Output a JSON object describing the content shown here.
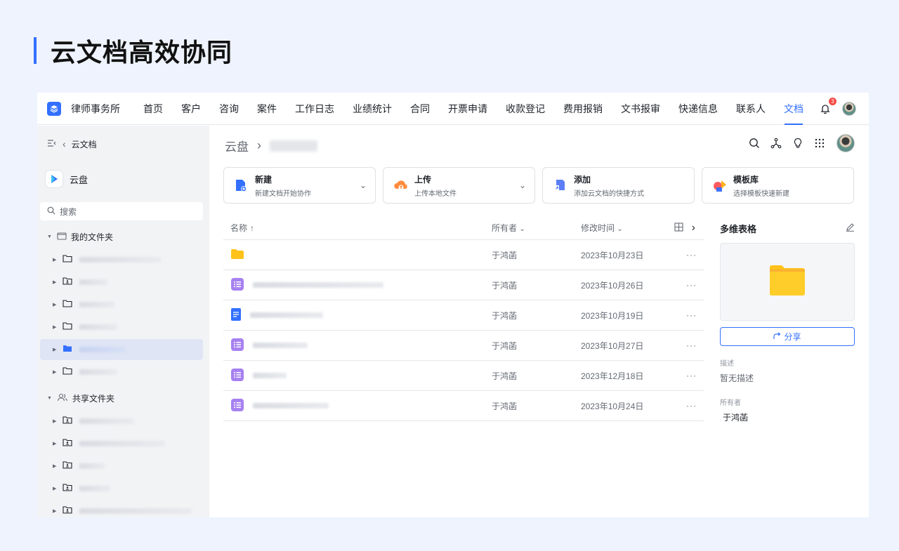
{
  "hero": {
    "title": "云文档高效协同"
  },
  "topnav": {
    "brand": "律师事务所",
    "items": [
      "首页",
      "客户",
      "咨询",
      "案件",
      "工作日志",
      "业绩统计",
      "合同",
      "开票申请",
      "收款登记",
      "费用报销",
      "文书报审",
      "快递信息",
      "联系人",
      "文档"
    ],
    "active": "文档",
    "notification_count": "3"
  },
  "sidebar": {
    "back_label": "云文档",
    "drive_label": "云盘",
    "search_placeholder": "搜索",
    "my_folder": "我的文件夹",
    "shared_folder": "共享文件夹"
  },
  "main": {
    "breadcrumb_root": "云盘",
    "cards": [
      {
        "title": "新建",
        "sub": "新建文档开始协作",
        "has_menu": true
      },
      {
        "title": "上传",
        "sub": "上传本地文件",
        "has_menu": true
      },
      {
        "title": "添加",
        "sub": "添加云文档的快捷方式",
        "has_menu": false
      },
      {
        "title": "模板库",
        "sub": "选择模板快速新建",
        "has_menu": false
      }
    ],
    "table": {
      "col_name": "名称",
      "col_owner": "所有者",
      "col_time": "修改时间",
      "rows": [
        {
          "type": "folder",
          "owner": "于鸿菡",
          "time": "2023年10月23日"
        },
        {
          "type": "sheet",
          "owner": "于鸿菡",
          "time": "2023年10月26日"
        },
        {
          "type": "doc",
          "owner": "于鸿菡",
          "time": "2023年10月19日"
        },
        {
          "type": "sheet",
          "owner": "于鸿菡",
          "time": "2023年10月27日"
        },
        {
          "type": "sheet",
          "owner": "于鸿菡",
          "time": "2023年12月18日"
        },
        {
          "type": "sheet",
          "owner": "于鸿菡",
          "time": "2023年10月24日"
        }
      ],
      "more": "···"
    }
  },
  "panel": {
    "title": "多维表格",
    "share_label": "分享",
    "desc_label": "描述",
    "desc_value": "暂无描述",
    "owner_label": "所有者",
    "owner_value": "于鸿菡"
  },
  "colors": {
    "accent": "#3370ff",
    "folder": "#ffc21a",
    "sheet": "#a781f1",
    "background": "#eef3fd"
  }
}
